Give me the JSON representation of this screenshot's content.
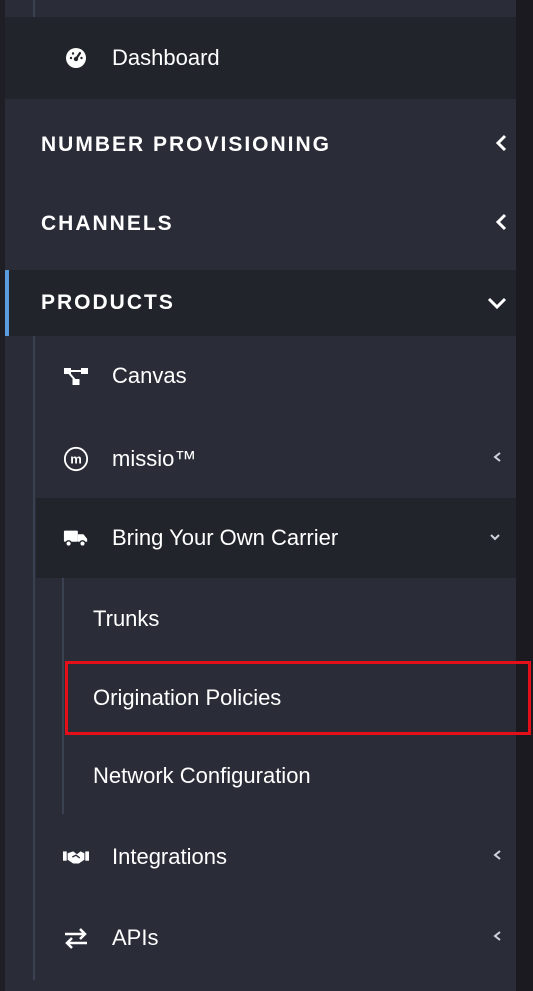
{
  "sidebar": {
    "dashboard": {
      "label": "Dashboard",
      "icon": "dashboard-icon"
    },
    "sections": {
      "number_provisioning": "NUMBER PROVISIONING",
      "channels": "CHANNELS",
      "products": "PRODUCTS"
    },
    "products": {
      "canvas": {
        "label": "Canvas",
        "icon": "canvas-icon"
      },
      "missio": {
        "label": "missio™",
        "icon": "missio-icon"
      },
      "byoc": {
        "label": "Bring Your Own Carrier",
        "icon": "truck-icon",
        "children": {
          "trunks": "Trunks",
          "origination_policies": "Origination Policies",
          "network_configuration": "Network Configuration"
        }
      },
      "integrations": {
        "label": "Integrations",
        "icon": "handshake-icon"
      },
      "apis": {
        "label": "APIs",
        "icon": "exchange-arrows-icon"
      }
    }
  },
  "colors": {
    "sidebar_bg": "#2a2d38",
    "active_row_bg": "#22242c",
    "accent_blue": "#5b9be0",
    "highlight_red": "#e3101a"
  }
}
